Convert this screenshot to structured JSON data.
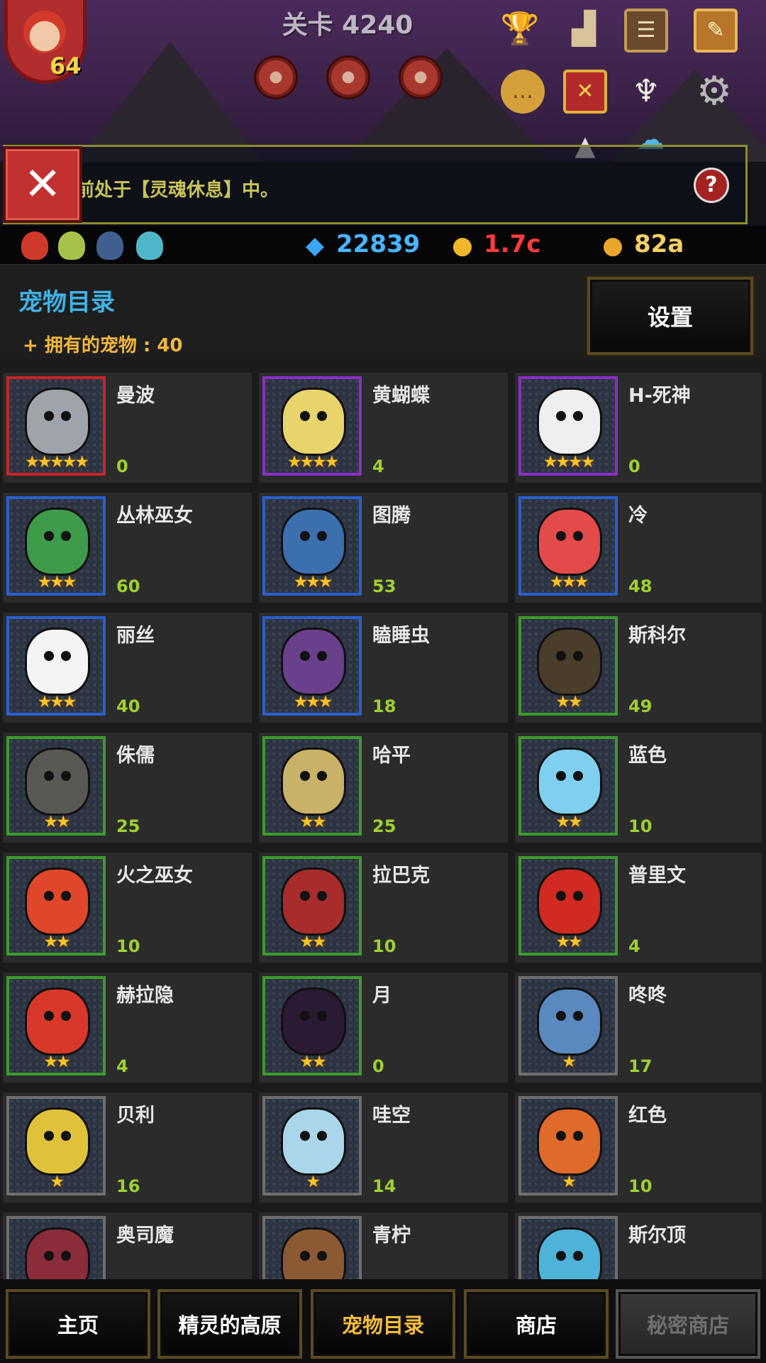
{
  "stage": {
    "title": "关卡 4240"
  },
  "player": {
    "level": "64"
  },
  "notice": {
    "text": "前处于【灵魂休息】中。",
    "close_label": "✕",
    "help_label": "?"
  },
  "resources": {
    "gems": "22839",
    "medals": "1.7c",
    "gold": "82a"
  },
  "pet_catalog": {
    "title": "宠物目录",
    "owned_label": "+ 拥有的宠物 : 40",
    "settings_label": "设置",
    "pets": [
      {
        "name": "曼波",
        "count": "0",
        "stars": "★★★★★",
        "rarity": "red",
        "color": "#9fa4ab"
      },
      {
        "name": "黄蝴蝶",
        "count": "4",
        "stars": "★★★★",
        "rarity": "purple",
        "color": "#e8d46a"
      },
      {
        "name": "H-死神",
        "count": "0",
        "stars": "★★★★",
        "rarity": "purple",
        "color": "#efefef"
      },
      {
        "name": "丛林巫女",
        "count": "60",
        "stars": "★★★",
        "rarity": "blue",
        "color": "#3e9b4a"
      },
      {
        "name": "图腾",
        "count": "53",
        "stars": "★★★",
        "rarity": "blue",
        "color": "#3b6fb0"
      },
      {
        "name": "冷",
        "count": "48",
        "stars": "★★★",
        "rarity": "blue",
        "color": "#e34a4a"
      },
      {
        "name": "丽丝",
        "count": "40",
        "stars": "★★★",
        "rarity": "blue",
        "color": "#f4f4f4"
      },
      {
        "name": "瞌睡虫",
        "count": "18",
        "stars": "★★★",
        "rarity": "blue",
        "color": "#6a3f8c"
      },
      {
        "name": "斯科尔",
        "count": "49",
        "stars": "★★",
        "rarity": "green",
        "color": "#4a3d2c"
      },
      {
        "name": "侏儒",
        "count": "25",
        "stars": "★★",
        "rarity": "green",
        "color": "#5a5852"
      },
      {
        "name": "哈平",
        "count": "25",
        "stars": "★★",
        "rarity": "green",
        "color": "#c9b267"
      },
      {
        "name": "蓝色",
        "count": "10",
        "stars": "★★",
        "rarity": "green",
        "color": "#7fd0f0"
      },
      {
        "name": "火之巫女",
        "count": "10",
        "stars": "★★",
        "rarity": "green",
        "color": "#e0462a"
      },
      {
        "name": "拉巴克",
        "count": "10",
        "stars": "★★",
        "rarity": "green",
        "color": "#a82c2c"
      },
      {
        "name": "普里文",
        "count": "4",
        "stars": "★★",
        "rarity": "green",
        "color": "#d02a22"
      },
      {
        "name": "赫拉隐",
        "count": "4",
        "stars": "★★",
        "rarity": "green",
        "color": "#d8382a"
      },
      {
        "name": "月",
        "count": "0",
        "stars": "★★",
        "rarity": "green",
        "color": "#2a1a33"
      },
      {
        "name": "咚咚",
        "count": "17",
        "stars": "★",
        "rarity": "gray",
        "color": "#5a89c0"
      },
      {
        "name": "贝利",
        "count": "16",
        "stars": "★",
        "rarity": "gray",
        "color": "#e0c23a"
      },
      {
        "name": "哇空",
        "count": "14",
        "stars": "★",
        "rarity": "gray",
        "color": "#a9d6ea"
      },
      {
        "name": "红色",
        "count": "10",
        "stars": "★",
        "rarity": "gray",
        "color": "#e06a2a"
      },
      {
        "name": "奥司魔",
        "count": "",
        "stars": "",
        "rarity": "gray",
        "color": "#8a2c3a"
      },
      {
        "name": "青柠",
        "count": "",
        "stars": "",
        "rarity": "gray",
        "color": "#8b5a34"
      },
      {
        "name": "斯尔顶",
        "count": "",
        "stars": "",
        "rarity": "gray",
        "color": "#4fb3d9"
      }
    ]
  },
  "nav": {
    "home": "主页",
    "plateau": "精灵的高原",
    "pet_catalog": "宠物目录",
    "shop": "商店",
    "secret_shop": "秘密商店"
  },
  "icons": {
    "trophy": "trophy-icon",
    "ranking": "ranking-icon",
    "book": "book-icon",
    "quest": "quest-icon",
    "chat": "chat-icon",
    "gift": "gift-icon",
    "angel": "angel-icon",
    "settings": "gear-icon"
  }
}
